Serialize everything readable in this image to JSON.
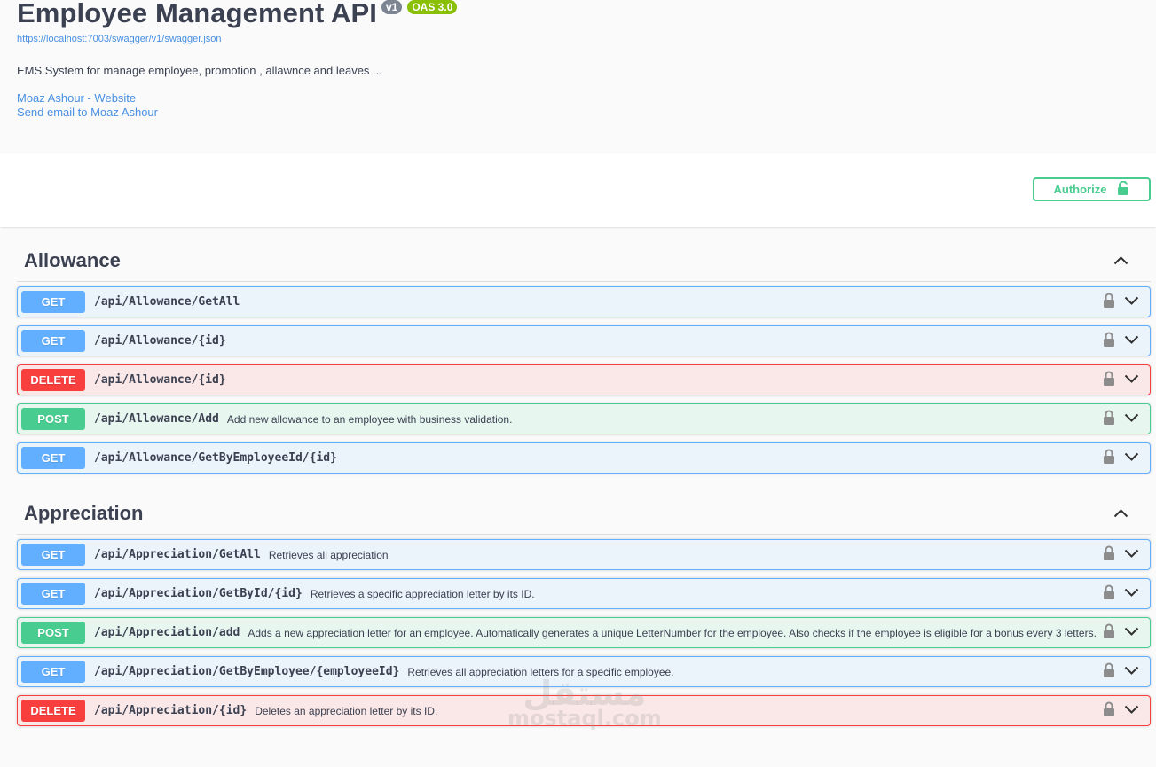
{
  "info": {
    "title": "Employee Management API",
    "version_badge": "v1",
    "oas_badge": "OAS 3.0",
    "spec_url": "https://localhost:7003/swagger/v1/swagger.json",
    "description": "EMS System for manage employee, promotion , allawnce and leaves ...",
    "contact_website": "Moaz Ashour - Website",
    "contact_email": "Send email to Moaz Ashour"
  },
  "scheme": {
    "authorize_label": "Authorize"
  },
  "colors": {
    "get": "#61affe",
    "delete": "#f93e3e",
    "post": "#49cc90",
    "badge_version": "#7d8492",
    "badge_oas": "#89bf04",
    "link": "#4990e2"
  },
  "tags": [
    {
      "name": "Allowance",
      "operations": [
        {
          "method": "GET",
          "path": "/api/Allowance/GetAll",
          "summary": ""
        },
        {
          "method": "GET",
          "path": "/api/Allowance/{id}",
          "summary": ""
        },
        {
          "method": "DELETE",
          "path": "/api/Allowance/{id}",
          "summary": ""
        },
        {
          "method": "POST",
          "path": "/api/Allowance/Add",
          "summary": "Add new allowance to an employee with business validation."
        },
        {
          "method": "GET",
          "path": "/api/Allowance/GetByEmployeeId/{id}",
          "summary": ""
        }
      ]
    },
    {
      "name": "Appreciation",
      "operations": [
        {
          "method": "GET",
          "path": "/api/Appreciation/GetAll",
          "summary": "Retrieves all appreciation"
        },
        {
          "method": "GET",
          "path": "/api/Appreciation/GetById/{id}",
          "summary": "Retrieves a specific appreciation letter by its ID."
        },
        {
          "method": "POST",
          "path": "/api/Appreciation/add",
          "summary": "Adds a new appreciation letter for an employee. Automatically generates a unique LetterNumber for the employee. Also checks if the employee is eligible for a bonus every 3 letters."
        },
        {
          "method": "GET",
          "path": "/api/Appreciation/GetByEmployee/{employeeId}",
          "summary": "Retrieves all appreciation letters for a specific employee."
        },
        {
          "method": "DELETE",
          "path": "/api/Appreciation/{id}",
          "summary": "Deletes an appreciation letter by its ID."
        }
      ]
    }
  ],
  "icons": {
    "lock": "lock-icon",
    "chevron_down": "chevron-down-icon",
    "chevron_up": "chevron-up-icon",
    "unlocked": "unlocked-icon"
  },
  "watermark": {
    "arabic": "مستقل",
    "latin": "mostaql.com"
  }
}
